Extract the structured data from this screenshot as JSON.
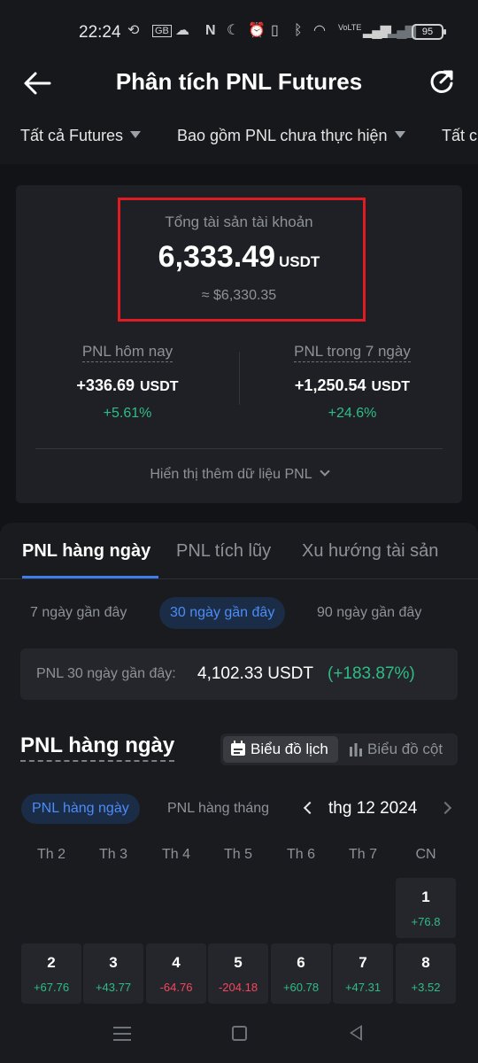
{
  "status_bar": {
    "time": "22:24",
    "battery": "95"
  },
  "header": {
    "title": "Phân tích PNL Futures"
  },
  "filters": [
    {
      "label": "Tất cả Futures"
    },
    {
      "label": "Bao gồm PNL chưa thực hiện"
    },
    {
      "label": "Tất c"
    }
  ],
  "summary_card": {
    "total_label": "Tổng tài sản tài khoản",
    "total_value": "6,333.49",
    "total_unit": "USDT",
    "total_usd": "≈ $6,330.35",
    "today": {
      "label": "PNL hôm nay",
      "value": "+336.69",
      "unit": "USDT",
      "percent": "+5.61%"
    },
    "week": {
      "label": "PNL trong 7 ngày",
      "value": "+1,250.54",
      "unit": "USDT",
      "percent": "+24.6%"
    },
    "more_label": "Hiển thị thêm dữ liệu PNL",
    "highlight_color": "#e01b22"
  },
  "tabs": [
    {
      "label": "PNL hàng ngày",
      "active": true
    },
    {
      "label": "PNL tích lũy",
      "active": false
    },
    {
      "label": "Xu hướng tài sản",
      "active": false
    }
  ],
  "ranges": [
    {
      "label": "7 ngày gần đây",
      "active": false
    },
    {
      "label": "30 ngày gần đây",
      "active": true
    },
    {
      "label": "90 ngày gần đây",
      "active": false
    }
  ],
  "range_summary": {
    "label": "PNL 30 ngày gần đây:",
    "value": "4,102.33 USDT",
    "percent": "(+183.87%)"
  },
  "daily_section": {
    "title": "PNL hàng ngày",
    "view_calendar": "Biểu đồ lịch",
    "view_bar": "Biểu đồ cột",
    "mode_daily": "PNL hàng ngày",
    "mode_monthly": "PNL hàng tháng",
    "month": "thg 12 2024"
  },
  "weekdays": [
    "Th 2",
    "Th 3",
    "Th 4",
    "Th 5",
    "Th 6",
    "Th 7",
    "CN"
  ],
  "days": [
    {
      "day": "1",
      "pnl": "+76.8"
    },
    {
      "day": "2",
      "pnl": "+67.76"
    },
    {
      "day": "3",
      "pnl": "+43.77"
    },
    {
      "day": "4",
      "pnl": "-64.76"
    },
    {
      "day": "5",
      "pnl": "-204.18"
    },
    {
      "day": "6",
      "pnl": "+60.78"
    },
    {
      "day": "7",
      "pnl": "+47.31"
    },
    {
      "day": "8",
      "pnl": "+3.52"
    }
  ],
  "colors": {
    "positive": "#2ebd85",
    "negative": "#f6465d",
    "accent": "#3d7df0",
    "background": "#17181c"
  }
}
